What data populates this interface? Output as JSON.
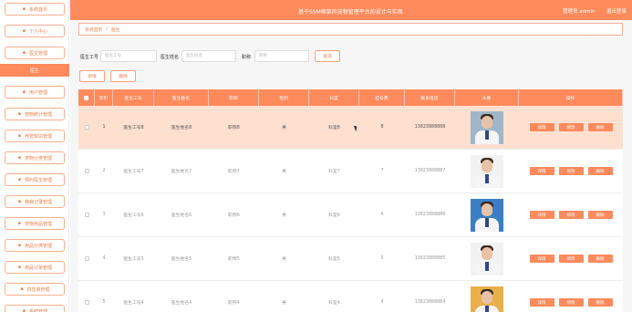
{
  "sidebar": {
    "items": [
      {
        "label": "系统首页",
        "icon": "home-icon",
        "active": false
      },
      {
        "label": "个人中心",
        "icon": "user-icon",
        "active": false
      },
      {
        "label": "医生管理",
        "icon": "doctor-icon",
        "active": false
      },
      {
        "label": "医生",
        "icon": "",
        "active": true
      },
      {
        "label": "用户管理",
        "icon": "users-icon",
        "active": false
      },
      {
        "label": "宠物統计管理",
        "icon": "chart-icon",
        "active": false
      },
      {
        "label": "养宠知识管理",
        "icon": "book-icon",
        "active": false
      },
      {
        "label": "宠物分类管理",
        "icon": "category-icon",
        "active": false
      },
      {
        "label": "预约医生管理",
        "icon": "calendar-icon",
        "active": false
      },
      {
        "label": "疾病记录管理",
        "icon": "record-icon",
        "active": false
      },
      {
        "label": "宠物用品管理",
        "icon": "box-icon",
        "active": false
      },
      {
        "label": "用品分类管理",
        "icon": "grid-icon",
        "active": false
      },
      {
        "label": "用品订单管理",
        "icon": "order-icon",
        "active": false
      },
      {
        "label": "供应商管理",
        "icon": "supplier-icon",
        "active": false
      },
      {
        "label": "系统管理",
        "icon": "settings-icon",
        "active": false
      }
    ]
  },
  "header": {
    "title": "基于SSM框架的宠物管理平台的设计与实现",
    "user": "管理员 admin",
    "logout": "退出登录"
  },
  "breadcrumb": {
    "home": "系统首页",
    "sep": "/",
    "current": "医生"
  },
  "search": {
    "fields": [
      {
        "label": "医生工号",
        "placeholder": "医生工号"
      },
      {
        "label": "医生姓名",
        "placeholder": "医生姓名"
      },
      {
        "label": "职称",
        "placeholder": "职称"
      }
    ],
    "query_label": "查询"
  },
  "actions": {
    "add_label": "新增",
    "delete_label": "删除"
  },
  "table": {
    "columns": [
      "索引",
      "医生工号",
      "医生姓名",
      "职称",
      "性别",
      "科室",
      "挂号费",
      "联系电话",
      "头像",
      "操作"
    ],
    "rows": [
      {
        "index": "1",
        "id": "医生工号8",
        "name": "医生姓名8",
        "title": "职称8",
        "gender": "男",
        "dept": "科室8",
        "fee": "8",
        "phone": "13823888888"
      },
      {
        "index": "2",
        "id": "医生工号7",
        "name": "医生姓名7",
        "title": "职称7",
        "gender": "男",
        "dept": "科室7",
        "fee": "7",
        "phone": "13823888887"
      },
      {
        "index": "3",
        "id": "医生工号6",
        "name": "医生姓名6",
        "title": "职称6",
        "gender": "男",
        "dept": "科室6",
        "fee": "6",
        "phone": "13823888886"
      },
      {
        "index": "4",
        "id": "医生工号5",
        "name": "医生姓名5",
        "title": "职称5",
        "gender": "男",
        "dept": "科室5",
        "fee": "5",
        "phone": "13823888885"
      },
      {
        "index": "5",
        "id": "医生工号4",
        "name": "医生姓名4",
        "title": "职称4",
        "gender": "男",
        "dept": "科室4",
        "fee": "4",
        "phone": "13823888884"
      }
    ],
    "op_labels": {
      "detail": "详情",
      "edit": "修改",
      "delete": "删除"
    }
  },
  "colors": {
    "accent": "#ff8a5c",
    "highlight_row": "#fde0d0",
    "border": "#f7b08f"
  }
}
